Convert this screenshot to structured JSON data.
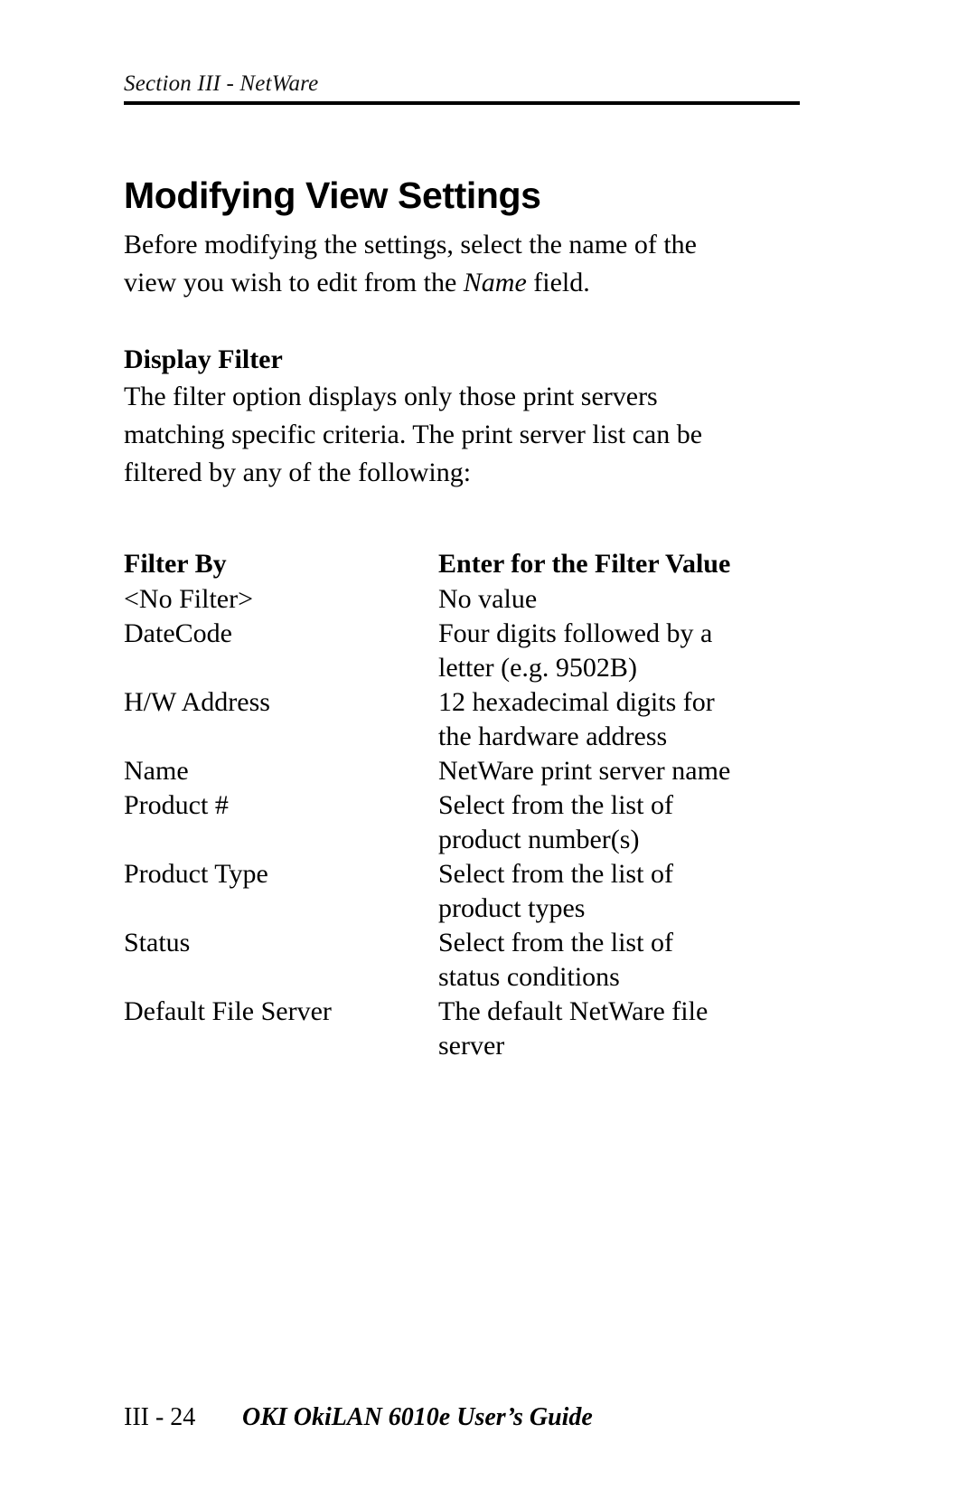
{
  "header": {
    "running_head": "Section III - NetWare"
  },
  "main": {
    "title": "Modifying View Settings",
    "intro_before_italic": "Before modifying the settings, select the name of the view you wish to edit from the ",
    "intro_italic": "Name",
    "intro_after_italic": " field.",
    "subhead": "Display Filter",
    "subhead_body": "The filter option displays only those print servers matching specific criteria. The print server list can be filtered by any of the following:"
  },
  "table": {
    "headers": [
      "Filter By",
      "Enter for the Filter Value"
    ],
    "rows": [
      {
        "filter_by": "<No Filter>",
        "value_line1": "No value",
        "value_line2": ""
      },
      {
        "filter_by": "DateCode",
        "value_line1": "Four digits followed by a",
        "value_line2": "letter (e.g. 9502B)"
      },
      {
        "filter_by": "H/W Address",
        "value_line1": "12 hexadecimal digits for",
        "value_line2": "the hardware address"
      },
      {
        "filter_by": "Name",
        "value_line1": "NetWare print server name",
        "value_line2": ""
      },
      {
        "filter_by": "Product #",
        "value_line1": "Select from the list of",
        "value_line2": "product number(s)"
      },
      {
        "filter_by": "Product Type",
        "value_line1": "Select from the list of",
        "value_line2": "product types"
      },
      {
        "filter_by": "Status",
        "value_line1": "Select from the list of",
        "value_line2": "status conditions"
      },
      {
        "filter_by": "Default File Server",
        "value_line1": "The default NetWare file",
        "value_line2": "server"
      }
    ]
  },
  "footer": {
    "page_number": "III - 24",
    "document_title": "OKI OkiLAN 6010e User’s Guide"
  }
}
